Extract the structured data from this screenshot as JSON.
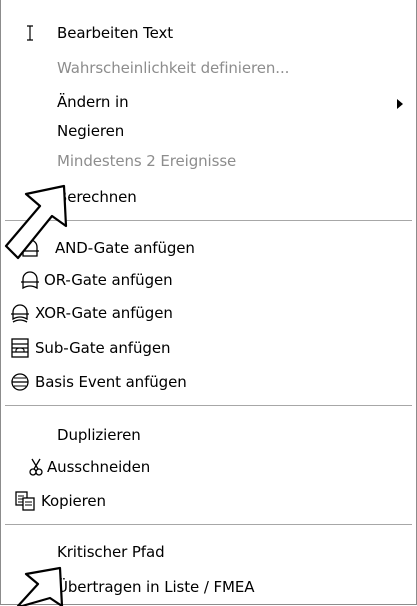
{
  "menu": {
    "group1": {
      "edit_text": "Bearbeiten Text",
      "define_probability": "Wahrscheinlichkeit definieren...",
      "change_to": "Ändern in",
      "negate": "Negieren",
      "min_two_events": "Mindestens 2 Ereignisse",
      "calculate": "Berechnen"
    },
    "group2": {
      "add_and_gate": "AND-Gate anfügen",
      "add_or_gate": "OR-Gate anfügen",
      "add_xor_gate": "XOR-Gate anfügen",
      "add_sub_gate": "Sub-Gate anfügen",
      "add_basis_event": "Basis Event anfügen"
    },
    "group3": {
      "duplicate": "Duplizieren",
      "cut": "Ausschneiden",
      "copy": "Kopieren"
    },
    "group4": {
      "critical_path": "Kritischer Pfad",
      "transfer_list": "Übertragen in Liste / FMEA"
    }
  },
  "icons": {
    "edit_text": "text-cursor-icon",
    "and_gate": "and-gate-icon",
    "or_gate": "or-gate-icon",
    "xor_gate": "xor-gate-icon",
    "sub_gate": "sub-gate-icon",
    "basis_event": "basis-event-icon",
    "cut": "scissors-icon",
    "copy": "copy-icon",
    "submenu": "chevron-right-icon"
  },
  "colors": {
    "disabled_text": "#8d8d8d",
    "separator": "#a7a7a7"
  }
}
